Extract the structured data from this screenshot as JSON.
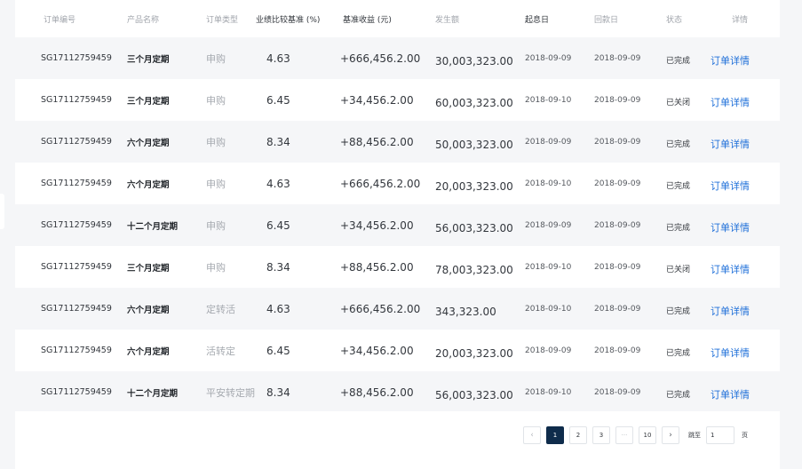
{
  "table": {
    "headers": {
      "order_id": "订单编号",
      "product": "产品名称",
      "order_type": "订单类型",
      "rate": "业绩比较基准 (%)",
      "income": "基准收益 (元)",
      "amount": "发生额",
      "start_date": "起息日",
      "return_date": "回款日",
      "status": "状态",
      "detail": "详情"
    },
    "rows": [
      {
        "order_id": "SG17112759459",
        "product": "三个月定期",
        "order_type": "申购",
        "rate": "4.63",
        "income": "+666,456.2.00",
        "amount": "30,003,323.00",
        "start_date": "2018-09-09",
        "return_date": "2018-09-09",
        "status": "已完成",
        "detail": "订单详情"
      },
      {
        "order_id": "SG17112759459",
        "product": "三个月定期",
        "order_type": "申购",
        "rate": "6.45",
        "income": "+34,456.2.00",
        "amount": "60,003,323.00",
        "start_date": "2018-09-10",
        "return_date": "2018-09-09",
        "status": "已关闭",
        "detail": "订单详情"
      },
      {
        "order_id": "SG17112759459",
        "product": "六个月定期",
        "order_type": "申购",
        "rate": "8.34",
        "income": "+88,456.2.00",
        "amount": "50,003,323.00",
        "start_date": "2018-09-09",
        "return_date": "2018-09-09",
        "status": "已完成",
        "detail": "订单详情"
      },
      {
        "order_id": "SG17112759459",
        "product": "六个月定期",
        "order_type": "申购",
        "rate": "4.63",
        "income": "+666,456.2.00",
        "amount": "20,003,323.00",
        "start_date": "2018-09-10",
        "return_date": "2018-09-09",
        "status": "已完成",
        "detail": "订单详情"
      },
      {
        "order_id": "SG17112759459",
        "product": "十二个月定期",
        "order_type": "申购",
        "rate": "6.45",
        "income": "+34,456.2.00",
        "amount": "56,003,323.00",
        "start_date": "2018-09-09",
        "return_date": "2018-09-09",
        "status": "已完成",
        "detail": "订单详情"
      },
      {
        "order_id": "SG17112759459",
        "product": "三个月定期",
        "order_type": "申购",
        "rate": "8.34",
        "income": "+88,456.2.00",
        "amount": "78,003,323.00",
        "start_date": "2018-09-10",
        "return_date": "2018-09-09",
        "status": "已关闭",
        "detail": "订单详情"
      },
      {
        "order_id": "SG17112759459",
        "product": "六个月定期",
        "order_type": "定转活",
        "rate": "4.63",
        "income": "+666,456.2.00",
        "amount": "343,323.00",
        "start_date": "2018-09-10",
        "return_date": "2018-09-09",
        "status": "已完成",
        "detail": "订单详情"
      },
      {
        "order_id": "SG17112759459",
        "product": "六个月定期",
        "order_type": "活转定",
        "rate": "6.45",
        "income": "+34,456.2.00",
        "amount": "20,003,323.00",
        "start_date": "2018-09-09",
        "return_date": "2018-09-09",
        "status": "已完成",
        "detail": "订单详情"
      },
      {
        "order_id": "SG17112759459",
        "product": "十二个月定期",
        "order_type": "平安转定期",
        "rate": "8.34",
        "income": "+88,456.2.00",
        "amount": "56,003,323.00",
        "start_date": "2018-09-10",
        "return_date": "2018-09-09",
        "status": "已完成",
        "detail": "订单详情"
      }
    ]
  },
  "pagination": {
    "prev_icon": "‹",
    "pages": [
      "1",
      "2",
      "3"
    ],
    "current_page": "1",
    "ellipsis": "···",
    "last_page": "10",
    "next_icon": "›",
    "jump_label": "跳至",
    "jump_value": "1",
    "page_unit": "页"
  },
  "colors": {
    "accent_link": "#1e6fd9",
    "active_page": "#0f2c4b",
    "background": "#f5f6f8"
  }
}
